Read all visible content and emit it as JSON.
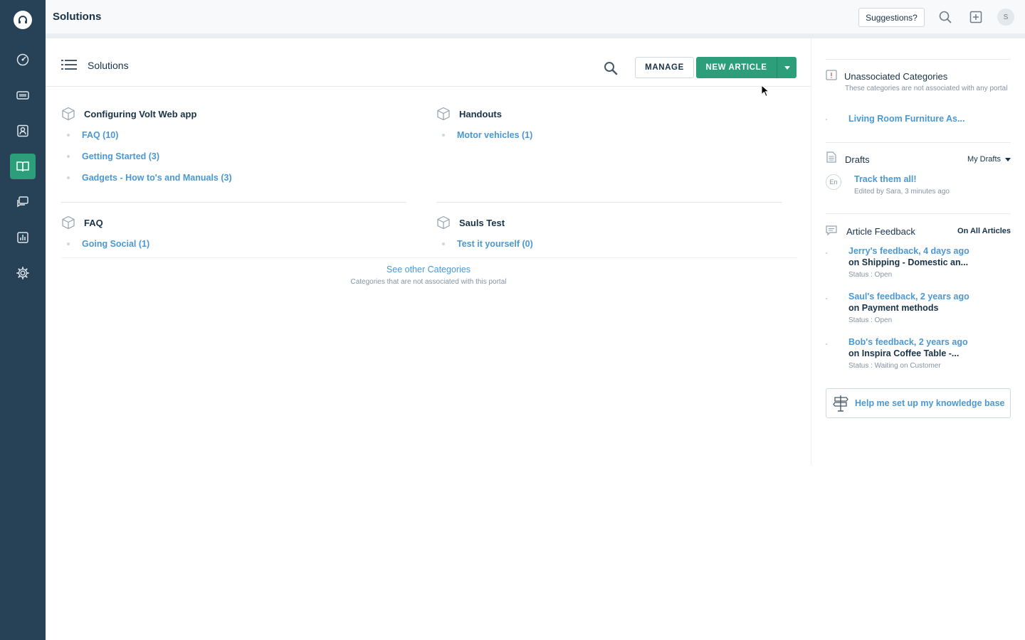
{
  "header": {
    "title": "Solutions",
    "suggestions_label": "Suggestions?",
    "avatar_initial": "S"
  },
  "main": {
    "title": "Solutions",
    "manage_label": "MANAGE",
    "new_article_label": "NEW ARTICLE",
    "categories": [
      {
        "name": "Configuring Volt Web app",
        "folders": [
          "FAQ  (10)",
          "Getting Started  (3)",
          "Gadgets - How to's and Manuals  (3)"
        ]
      },
      {
        "name": "Handouts",
        "folders": [
          "Motor vehicles  (1)"
        ]
      },
      {
        "name": "FAQ",
        "folders": [
          "Going Social  (1)"
        ]
      },
      {
        "name": "Sauls Test",
        "folders": [
          "Test it yourself  (0)"
        ]
      }
    ],
    "see_other_label": "See other Categories",
    "see_other_sub": "Categories that are not associated with this portal"
  },
  "right": {
    "unassociated": {
      "title": "Unassociated Categories",
      "subtitle": "These categories are not associated with any portal",
      "item": "Living Room Furniture As..."
    },
    "drafts": {
      "title": "Drafts",
      "filter": "My Drafts",
      "lang_badge": "En",
      "item_title": "Track them all!",
      "item_meta": "Edited by Sara, 3 minutes ago"
    },
    "feedback": {
      "title": "Article Feedback",
      "filter": "On All Articles",
      "items": [
        {
          "who": "Jerry's feedback, 4 days ago",
          "article": "on Shipping - Domestic an...",
          "status": "Status : Open"
        },
        {
          "who": "Saul's feedback, 2 years ago",
          "article": "on Payment methods",
          "status": "Status : Open"
        },
        {
          "who": "Bob's feedback, 2 years ago",
          "article": "on Inspira Coffee Table -...",
          "status": "Status : Waiting on Customer"
        }
      ]
    },
    "help_label": "Help me set up my knowledge base"
  },
  "colors": {
    "sidebar": "#274156",
    "accent_green": "#2c9e7a",
    "link_blue": "#4a98d3"
  }
}
